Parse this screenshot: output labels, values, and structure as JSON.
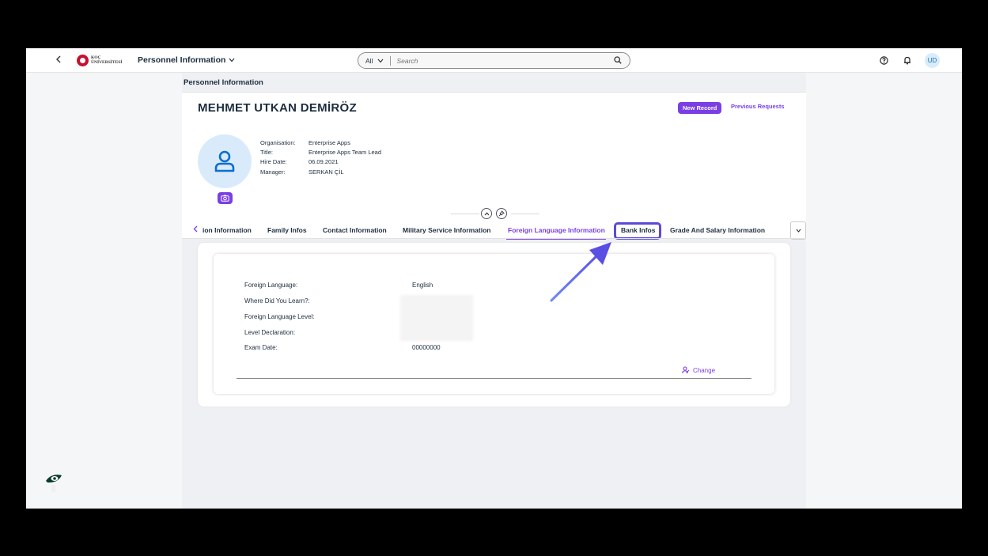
{
  "shell": {
    "back_icon": "chevron-left-icon",
    "logo_line1": "KOÇ",
    "logo_line2": "ÜNİVERSİTESİ",
    "app_title": "Personnel Information",
    "search_scope": "All",
    "search_placeholder": "Search",
    "user_initials": "UD",
    "accent_color": "#7a3fe4"
  },
  "page": {
    "title": "Personnel Information",
    "employee_name": "MEHMET UTKAN DEMİRÖZ",
    "new_record_label": "New Record",
    "previous_requests_label": "Previous Requests",
    "attributes": [
      {
        "label": "Organisation:",
        "value": "Enterprise Apps"
      },
      {
        "label": "Title:",
        "value": "Enterprise Apps Team Lead"
      },
      {
        "label": "Hire Date:",
        "value": "06.09.2021"
      },
      {
        "label": "Manager:",
        "value": "SERKAN ÇİL"
      }
    ]
  },
  "tabs": [
    {
      "label": "ion Information"
    },
    {
      "label": "Family Infos"
    },
    {
      "label": "Contact Information"
    },
    {
      "label": "Military Service Information"
    },
    {
      "label": "Foreign Language Information"
    },
    {
      "label": "Bank Infos"
    },
    {
      "label": "Grade And Salary Information"
    }
  ],
  "active_tab": "Foreign Language Information",
  "highlighted_tab": "Bank Infos",
  "form": {
    "fields": [
      {
        "label": "Foreign Language:",
        "value": "English"
      },
      {
        "label": "Where Did You Learn?:",
        "value": ""
      },
      {
        "label": "Foreign Language Level:",
        "value": ""
      },
      {
        "label": "Level Declaration:",
        "value": ""
      },
      {
        "label": "Exam Date:",
        "value": "00000000"
      }
    ],
    "change_label": "Change"
  }
}
